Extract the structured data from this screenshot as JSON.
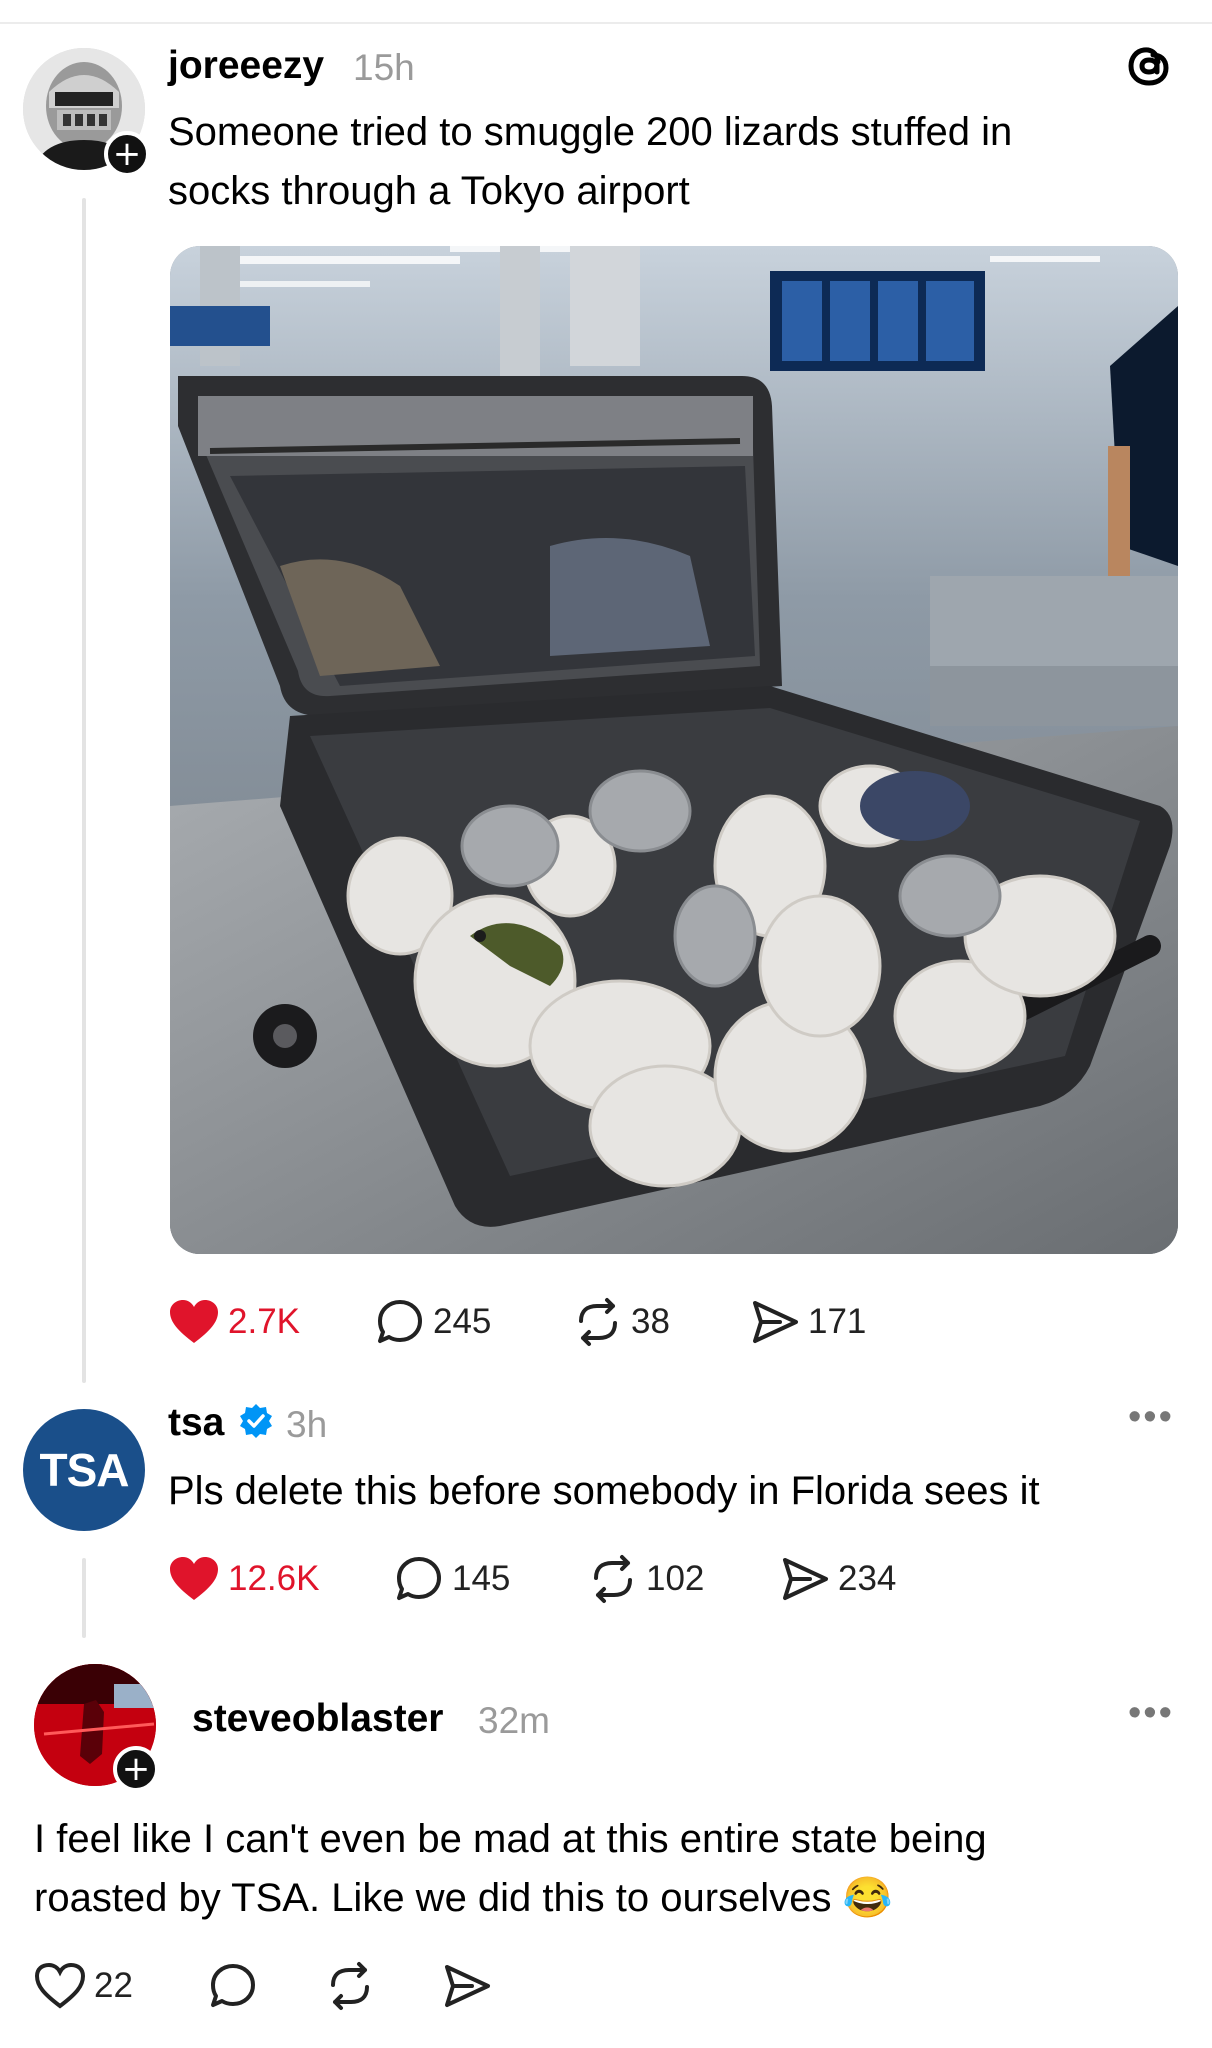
{
  "post": {
    "username": "joreeezy",
    "time": "15h",
    "text": "Someone tried to smuggle 200 lizards stuffed in socks through a Tokyo airport",
    "image_alt": "Open suitcase filled with white socks containing lizards at airport security",
    "likes": "2.7K",
    "replies": "245",
    "reposts": "38",
    "shares": "171",
    "liked": true
  },
  "reply1": {
    "username": "tsa",
    "avatar_text": "TSA",
    "verified": true,
    "time": "3h",
    "text": "Pls delete this before somebody in Florida sees it",
    "likes": "12.6K",
    "replies": "145",
    "reposts": "102",
    "shares": "234",
    "liked": true
  },
  "reply2": {
    "username": "steveoblaster",
    "time": "32m",
    "text": "I feel like I can't even be mad at this entire state being roasted by TSA. Like we did this to ourselves 😂",
    "likes": "22"
  },
  "colors": {
    "like_red": "#e0142b",
    "tsa_blue": "#1a4f8a",
    "verified_blue": "#0095f6"
  }
}
